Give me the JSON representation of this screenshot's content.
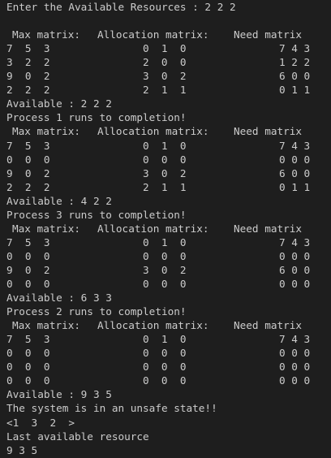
{
  "prompt_line": "Enter the Available Resources : 2 2 2",
  "header": {
    "max": "Max matrix:",
    "alloc": "Allocation matrix:",
    "need": "Need matrix"
  },
  "blocks": [
    {
      "max": [
        "7  5  3",
        "3  2  2",
        "9  0  2",
        "2  2  2"
      ],
      "alloc": [
        "0  1  0",
        "2  0  0",
        "3  0  2",
        "2  1  1"
      ],
      "need": [
        "7 4 3",
        "1 2 2",
        "6 0 0",
        "0 1 1"
      ],
      "available": "Available : 2 2 2",
      "message": "Process 1 runs to completion!"
    },
    {
      "max": [
        "7  5  3",
        "0  0  0",
        "9  0  2",
        "2  2  2"
      ],
      "alloc": [
        "0  1  0",
        "0  0  0",
        "3  0  2",
        "2  1  1"
      ],
      "need": [
        "7 4 3",
        "0 0 0",
        "6 0 0",
        "0 1 1"
      ],
      "available": "Available : 4 2 2",
      "message": "Process 3 runs to completion!"
    },
    {
      "max": [
        "7  5  3",
        "0  0  0",
        "9  0  2",
        "0  0  0"
      ],
      "alloc": [
        "0  1  0",
        "0  0  0",
        "3  0  2",
        "0  0  0"
      ],
      "need": [
        "7 4 3",
        "0 0 0",
        "6 0 0",
        "0 0 0"
      ],
      "available": "Available : 6 3 3",
      "message": "Process 2 runs to completion!"
    },
    {
      "max": [
        "7  5  3",
        "0  0  0",
        "0  0  0",
        "0  0  0"
      ],
      "alloc": [
        "0  1  0",
        "0  0  0",
        "0  0  0",
        "0  0  0"
      ],
      "need": [
        "7 4 3",
        "0 0 0",
        "0 0 0",
        "0 0 0"
      ],
      "available": "Available : 9 3 5",
      "message": "The system is in an unsafe state!!"
    }
  ],
  "sequence": "<1  3  2  >",
  "last_label": "Last available resource",
  "last_values": "9 3 5"
}
